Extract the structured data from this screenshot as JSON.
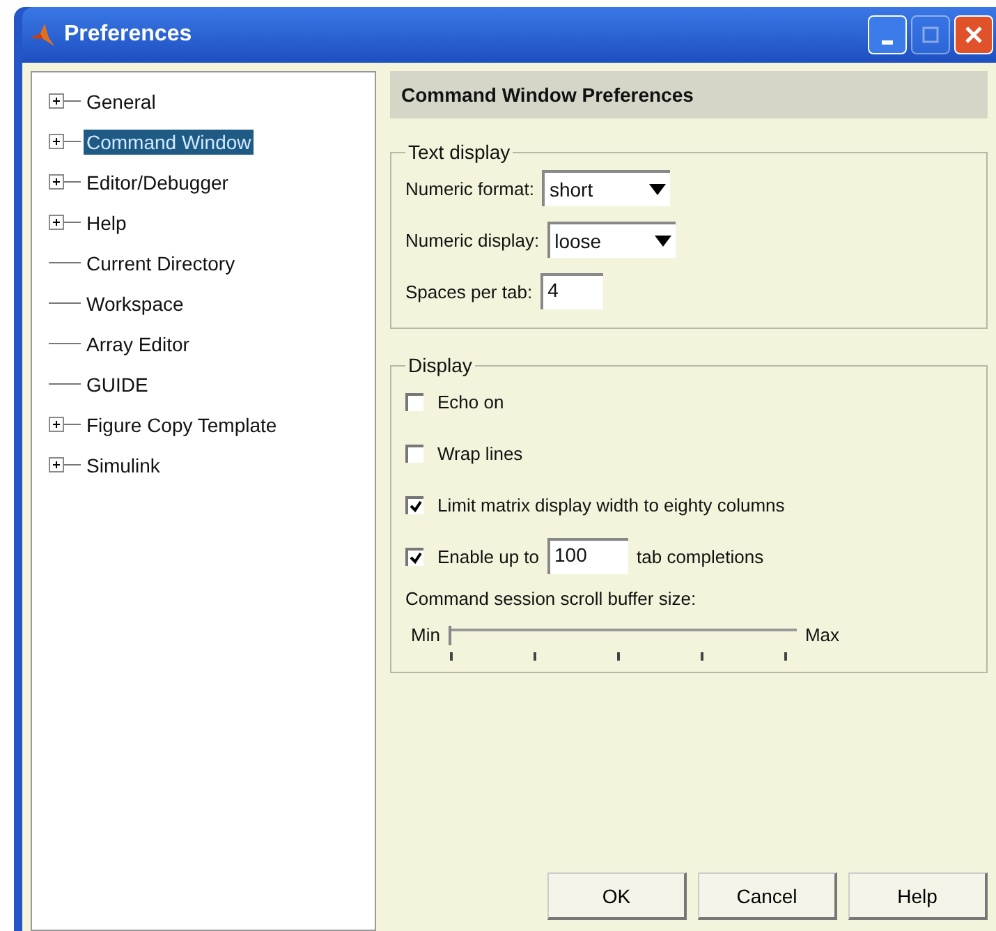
{
  "window": {
    "title": "Preferences"
  },
  "tree": [
    {
      "label": "General",
      "expandable": true,
      "selected": false
    },
    {
      "label": "Command Window",
      "expandable": true,
      "selected": true
    },
    {
      "label": "Editor/Debugger",
      "expandable": true,
      "selected": false
    },
    {
      "label": "Help",
      "expandable": true,
      "selected": false
    },
    {
      "label": "Current Directory",
      "expandable": false,
      "selected": false
    },
    {
      "label": "Workspace",
      "expandable": false,
      "selected": false
    },
    {
      "label": "Array Editor",
      "expandable": false,
      "selected": false
    },
    {
      "label": "GUIDE",
      "expandable": false,
      "selected": false
    },
    {
      "label": "Figure Copy Template",
      "expandable": true,
      "selected": false
    },
    {
      "label": "Simulink",
      "expandable": true,
      "selected": false
    }
  ],
  "panel_title": "Command Window Preferences",
  "text_display": {
    "title": "Text display",
    "fields": [
      {
        "kind": "dropdown",
        "label": "Numeric format:",
        "value": "short"
      },
      {
        "kind": "dropdown",
        "label": "Numeric display:",
        "value": "loose"
      },
      {
        "kind": "input",
        "label": "Spaces per tab:",
        "value": "4"
      }
    ]
  },
  "display": {
    "title": "Display",
    "options": [
      {
        "label": "Echo on",
        "checked": false
      },
      {
        "label": "Wrap lines",
        "checked": false
      },
      {
        "label": "Limit matrix display width to eighty columns",
        "checked": true
      },
      {
        "label": "Enable up to",
        "value": "100",
        "suffix": "tab completions",
        "checked": true
      }
    ],
    "slider": {
      "label": "Command session scroll buffer size:",
      "min_label": "Min",
      "max_label": "Max",
      "level": 0
    }
  },
  "buttons": [
    "OK",
    "Cancel",
    "Help"
  ]
}
